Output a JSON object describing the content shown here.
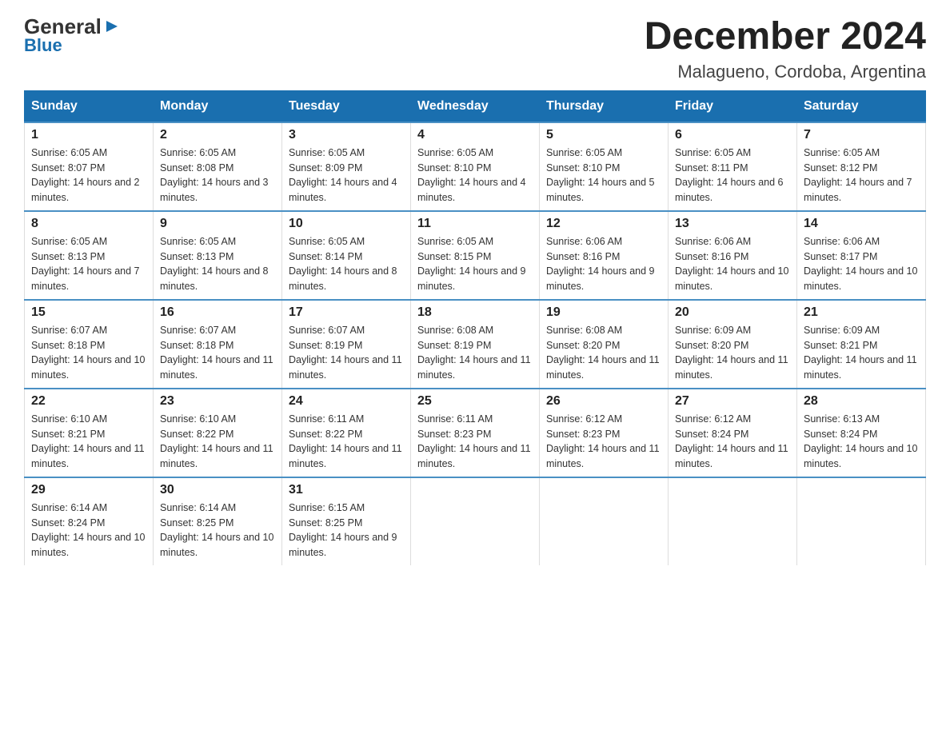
{
  "logo": {
    "general": "General",
    "blue": "Blue",
    "arrow": "▶"
  },
  "header": {
    "month": "December 2024",
    "location": "Malagueno, Cordoba, Argentina"
  },
  "days_of_week": [
    "Sunday",
    "Monday",
    "Tuesday",
    "Wednesday",
    "Thursday",
    "Friday",
    "Saturday"
  ],
  "weeks": [
    [
      {
        "day": "1",
        "sunrise": "Sunrise: 6:05 AM",
        "sunset": "Sunset: 8:07 PM",
        "daylight": "Daylight: 14 hours and 2 minutes."
      },
      {
        "day": "2",
        "sunrise": "Sunrise: 6:05 AM",
        "sunset": "Sunset: 8:08 PM",
        "daylight": "Daylight: 14 hours and 3 minutes."
      },
      {
        "day": "3",
        "sunrise": "Sunrise: 6:05 AM",
        "sunset": "Sunset: 8:09 PM",
        "daylight": "Daylight: 14 hours and 4 minutes."
      },
      {
        "day": "4",
        "sunrise": "Sunrise: 6:05 AM",
        "sunset": "Sunset: 8:10 PM",
        "daylight": "Daylight: 14 hours and 4 minutes."
      },
      {
        "day": "5",
        "sunrise": "Sunrise: 6:05 AM",
        "sunset": "Sunset: 8:10 PM",
        "daylight": "Daylight: 14 hours and 5 minutes."
      },
      {
        "day": "6",
        "sunrise": "Sunrise: 6:05 AM",
        "sunset": "Sunset: 8:11 PM",
        "daylight": "Daylight: 14 hours and 6 minutes."
      },
      {
        "day": "7",
        "sunrise": "Sunrise: 6:05 AM",
        "sunset": "Sunset: 8:12 PM",
        "daylight": "Daylight: 14 hours and 7 minutes."
      }
    ],
    [
      {
        "day": "8",
        "sunrise": "Sunrise: 6:05 AM",
        "sunset": "Sunset: 8:13 PM",
        "daylight": "Daylight: 14 hours and 7 minutes."
      },
      {
        "day": "9",
        "sunrise": "Sunrise: 6:05 AM",
        "sunset": "Sunset: 8:13 PM",
        "daylight": "Daylight: 14 hours and 8 minutes."
      },
      {
        "day": "10",
        "sunrise": "Sunrise: 6:05 AM",
        "sunset": "Sunset: 8:14 PM",
        "daylight": "Daylight: 14 hours and 8 minutes."
      },
      {
        "day": "11",
        "sunrise": "Sunrise: 6:05 AM",
        "sunset": "Sunset: 8:15 PM",
        "daylight": "Daylight: 14 hours and 9 minutes."
      },
      {
        "day": "12",
        "sunrise": "Sunrise: 6:06 AM",
        "sunset": "Sunset: 8:16 PM",
        "daylight": "Daylight: 14 hours and 9 minutes."
      },
      {
        "day": "13",
        "sunrise": "Sunrise: 6:06 AM",
        "sunset": "Sunset: 8:16 PM",
        "daylight": "Daylight: 14 hours and 10 minutes."
      },
      {
        "day": "14",
        "sunrise": "Sunrise: 6:06 AM",
        "sunset": "Sunset: 8:17 PM",
        "daylight": "Daylight: 14 hours and 10 minutes."
      }
    ],
    [
      {
        "day": "15",
        "sunrise": "Sunrise: 6:07 AM",
        "sunset": "Sunset: 8:18 PM",
        "daylight": "Daylight: 14 hours and 10 minutes."
      },
      {
        "day": "16",
        "sunrise": "Sunrise: 6:07 AM",
        "sunset": "Sunset: 8:18 PM",
        "daylight": "Daylight: 14 hours and 11 minutes."
      },
      {
        "day": "17",
        "sunrise": "Sunrise: 6:07 AM",
        "sunset": "Sunset: 8:19 PM",
        "daylight": "Daylight: 14 hours and 11 minutes."
      },
      {
        "day": "18",
        "sunrise": "Sunrise: 6:08 AM",
        "sunset": "Sunset: 8:19 PM",
        "daylight": "Daylight: 14 hours and 11 minutes."
      },
      {
        "day": "19",
        "sunrise": "Sunrise: 6:08 AM",
        "sunset": "Sunset: 8:20 PM",
        "daylight": "Daylight: 14 hours and 11 minutes."
      },
      {
        "day": "20",
        "sunrise": "Sunrise: 6:09 AM",
        "sunset": "Sunset: 8:20 PM",
        "daylight": "Daylight: 14 hours and 11 minutes."
      },
      {
        "day": "21",
        "sunrise": "Sunrise: 6:09 AM",
        "sunset": "Sunset: 8:21 PM",
        "daylight": "Daylight: 14 hours and 11 minutes."
      }
    ],
    [
      {
        "day": "22",
        "sunrise": "Sunrise: 6:10 AM",
        "sunset": "Sunset: 8:21 PM",
        "daylight": "Daylight: 14 hours and 11 minutes."
      },
      {
        "day": "23",
        "sunrise": "Sunrise: 6:10 AM",
        "sunset": "Sunset: 8:22 PM",
        "daylight": "Daylight: 14 hours and 11 minutes."
      },
      {
        "day": "24",
        "sunrise": "Sunrise: 6:11 AM",
        "sunset": "Sunset: 8:22 PM",
        "daylight": "Daylight: 14 hours and 11 minutes."
      },
      {
        "day": "25",
        "sunrise": "Sunrise: 6:11 AM",
        "sunset": "Sunset: 8:23 PM",
        "daylight": "Daylight: 14 hours and 11 minutes."
      },
      {
        "day": "26",
        "sunrise": "Sunrise: 6:12 AM",
        "sunset": "Sunset: 8:23 PM",
        "daylight": "Daylight: 14 hours and 11 minutes."
      },
      {
        "day": "27",
        "sunrise": "Sunrise: 6:12 AM",
        "sunset": "Sunset: 8:24 PM",
        "daylight": "Daylight: 14 hours and 11 minutes."
      },
      {
        "day": "28",
        "sunrise": "Sunrise: 6:13 AM",
        "sunset": "Sunset: 8:24 PM",
        "daylight": "Daylight: 14 hours and 10 minutes."
      }
    ],
    [
      {
        "day": "29",
        "sunrise": "Sunrise: 6:14 AM",
        "sunset": "Sunset: 8:24 PM",
        "daylight": "Daylight: 14 hours and 10 minutes."
      },
      {
        "day": "30",
        "sunrise": "Sunrise: 6:14 AM",
        "sunset": "Sunset: 8:25 PM",
        "daylight": "Daylight: 14 hours and 10 minutes."
      },
      {
        "day": "31",
        "sunrise": "Sunrise: 6:15 AM",
        "sunset": "Sunset: 8:25 PM",
        "daylight": "Daylight: 14 hours and 9 minutes."
      },
      {
        "day": "",
        "sunrise": "",
        "sunset": "",
        "daylight": ""
      },
      {
        "day": "",
        "sunrise": "",
        "sunset": "",
        "daylight": ""
      },
      {
        "day": "",
        "sunrise": "",
        "sunset": "",
        "daylight": ""
      },
      {
        "day": "",
        "sunrise": "",
        "sunset": "",
        "daylight": ""
      }
    ]
  ]
}
